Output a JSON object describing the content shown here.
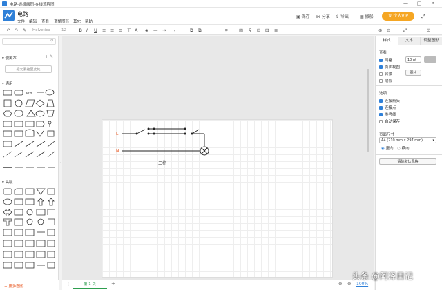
{
  "window": {
    "title": "电路-迅捷画图-在线流程图"
  },
  "doc": {
    "name": "电路"
  },
  "menu": [
    "文件",
    "编辑",
    "查看",
    "调整图形",
    "其它",
    "帮助"
  ],
  "header": {
    "save": "保存",
    "share": "分享",
    "export": "导出",
    "draft": "撤船",
    "upgrade": "个人VIP"
  },
  "toolbar": {
    "font": "Helvetica",
    "size": "12"
  },
  "left": {
    "search_placeholder": "",
    "scratch_title": "便笺本",
    "scratch_btn": "把元素拖至此处",
    "general_title": "通用",
    "advanced_title": "高级",
    "more_shapes": "+ 更多图形..."
  },
  "canvas": {
    "label_L": "L",
    "label_N": "N",
    "caption": "二控一"
  },
  "right": {
    "tabs": [
      "样式",
      "文本",
      "调整图形"
    ],
    "view_title": "查看",
    "grid": "网格",
    "grid_value": "10 pt",
    "page_view": "页面视图",
    "background": "背景",
    "bg_btn": "图片",
    "shadow": "阴影",
    "options_title": "选项",
    "connection_arrows": "连接箭头",
    "connection_points": "连接点",
    "guides": "参考线",
    "autosave": "自动保存",
    "paper_title": "页面尺寸",
    "paper_size": "A4 (210 mm x 297 mm)",
    "portrait": "竖向",
    "landscape": "横向",
    "reset_btn": "清除默认风格"
  },
  "bottom": {
    "page_tab": "第 1 页",
    "zoom": "100%"
  },
  "watermark": "头条 @阿泽日记"
}
